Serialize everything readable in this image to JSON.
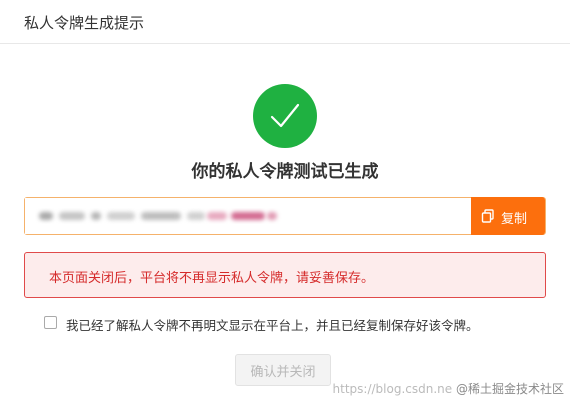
{
  "dialog": {
    "title": "私人令牌生成提示",
    "success_heading": "你的私人令牌测试已生成",
    "token": {
      "value": "",
      "copy_label": "复制"
    },
    "warning": "本页面关闭后，平台将不再显示私人令牌，请妥善保存。",
    "agreement": {
      "checked": false,
      "label": "我已经了解私人令牌不再明文显示在平台上，并且已经复制保存好该令牌。"
    },
    "confirm_label": "确认并关闭"
  },
  "watermark": {
    "url": "https://blog.csdn.ne",
    "brand": "@稀土掘金技术社区"
  },
  "colors": {
    "success": "#1fb141",
    "accent": "#fc6f0d",
    "warning_text": "#d52b2b",
    "warning_bg": "#fdecec"
  },
  "icons": {
    "success": "check-circle-icon",
    "copy": "copy-icon"
  }
}
